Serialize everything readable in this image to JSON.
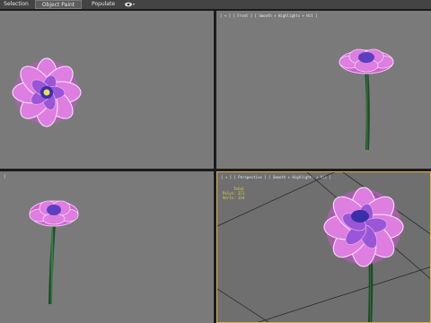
{
  "toolbar": {
    "tabs": [
      {
        "label": "Selection"
      },
      {
        "label": "Object Paint"
      },
      {
        "label": "Populate"
      }
    ],
    "eye_icon": "eye-icon"
  },
  "viewports": {
    "top_left": {
      "label": ""
    },
    "top_right": {
      "label": "[ + ] [ Front ] [ Smooth + Highlights + Hit ]"
    },
    "bottom_left": {
      "label": "["
    },
    "bottom_right": {
      "label": "[ + ] [ Perspective ] [ Smooth + Highlights + Hit ]",
      "stats": {
        "header": "Total",
        "polys_label": "Polys:",
        "polys_value": "371",
        "verts_label": "Verts:",
        "verts_value": "134"
      }
    }
  },
  "colors": {
    "viewport_bg": "#7a7a7a",
    "active_border": "#d6b34a",
    "petal": "#d86ad8",
    "petal_light": "#f3c6f3",
    "center": "#3a2fa8",
    "stem": "#2e6a3b"
  }
}
